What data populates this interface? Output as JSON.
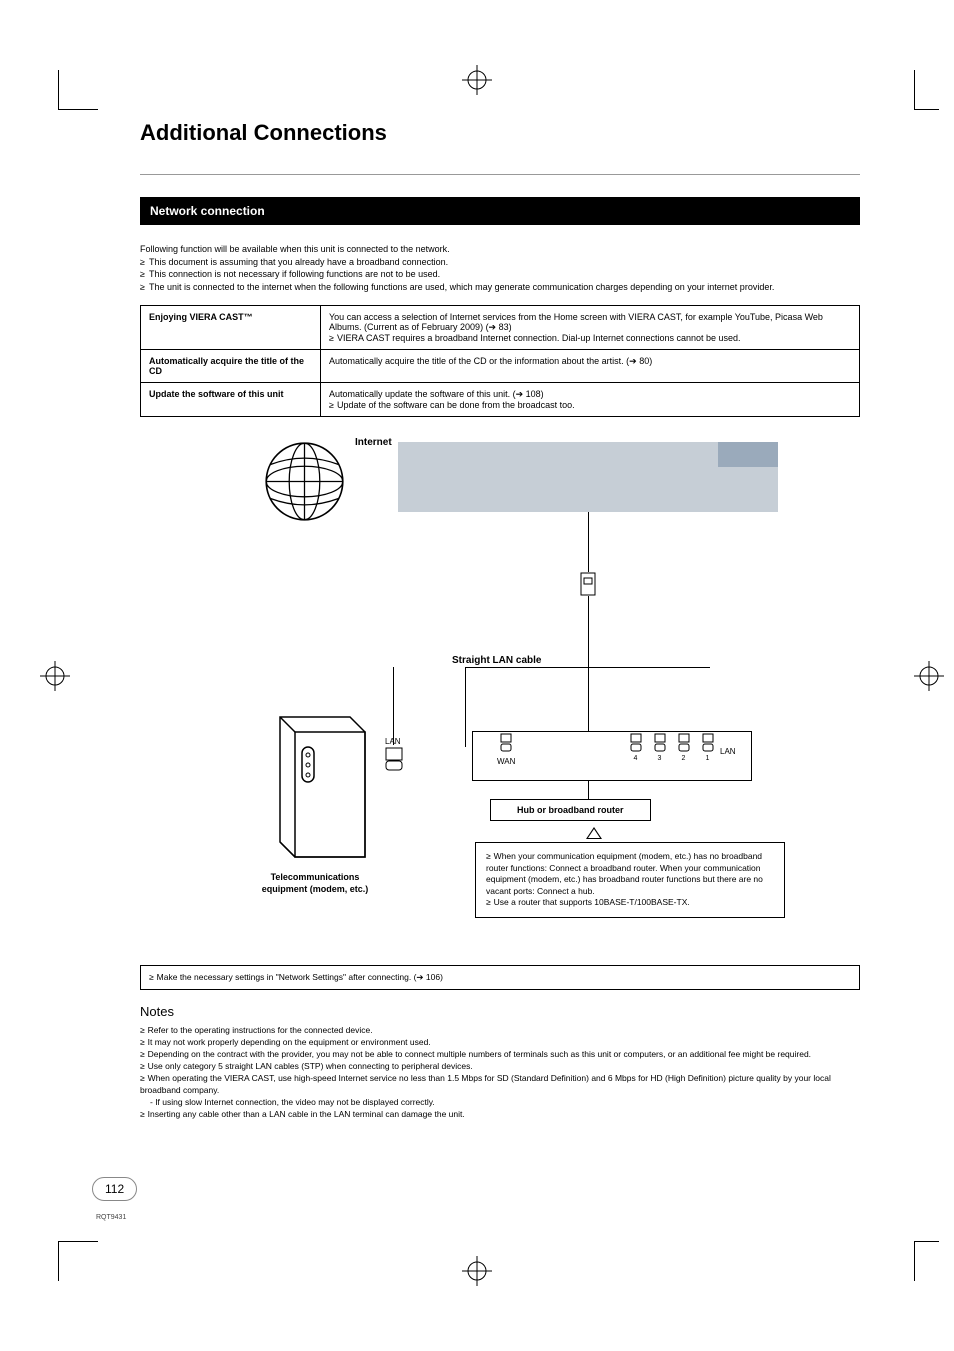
{
  "title": "Additional Connections",
  "section_heading": "Network connection",
  "intro_text": "Following function will be available when this unit is connected to the network.",
  "intro_bullets": [
    "This document is assuming that you already have a broadband connection.",
    "This connection is not necessary if following functions are not to be used.",
    "The unit is connected to the internet when the following functions are used, which may generate communication charges depending on your internet provider."
  ],
  "features": [
    {
      "label": "Enjoying VIERA CAST™",
      "desc": "You can access a selection of Internet services from the Home screen with VIERA CAST, for example YouTube, Picasa Web Albums. (Current as of February 2009) (➔ 83)",
      "bullets": [
        "VIERA CAST requires a broadband Internet connection. Dial-up Internet connections cannot be used."
      ]
    },
    {
      "label": "Automatically acquire the title of the CD",
      "desc": "Automatically acquire the title of the CD or the information about the artist. (➔ 80)",
      "bullets": []
    },
    {
      "label": "Update the software of this unit",
      "desc": "Automatically update the software of this unit. (➔ 108)",
      "bullets": [
        "Update of the software can be done from the broadcast too."
      ]
    }
  ],
  "diagram": {
    "internet": "Internet",
    "lan_cable": "Straight LAN cable",
    "hub_router": "Hub or broadband router",
    "wan": "WAN",
    "lan": "LAN",
    "ports": {
      "p1": "1",
      "p2": "2",
      "p3": "3",
      "p4": "4"
    },
    "modem_label_1": "Telecommunications",
    "modem_label_2": "equipment (modem, etc.)",
    "router_notes": [
      "When your communication equipment (modem, etc.) has no broadband router functions: Connect a broadband router. When your communication equipment (modem, etc.) has broadband router functions but there are no vacant ports: Connect a hub.",
      "Use a router that supports 10BASE-T/100BASE-TX."
    ]
  },
  "settings_note": "Make the necessary settings in \"Network Settings\" after connecting. (➔ 106)",
  "notes_heading": "Notes",
  "notes": [
    "Refer to the operating instructions for the connected device.",
    "It may not work properly depending on the equipment or environment used.",
    "Depending on the contract with the provider, you may not be able to connect multiple numbers of terminals such as this unit or computers, or an additional fee might be required.",
    "Use only category 5 straight LAN cables (STP) when connecting to peripheral devices.",
    "When operating the VIERA CAST, use high-speed Internet service no less than 1.5 Mbps for SD (Standard Definition) and 6 Mbps for HD (High Definition) picture quality by your local broadband company.",
    "Inserting any cable other than a LAN cable in the LAN terminal can damage the unit."
  ],
  "notes_sub": "- If using slow Internet connection, the video may not be displayed correctly.",
  "page_number": "112",
  "footer_code": "RQT9431"
}
